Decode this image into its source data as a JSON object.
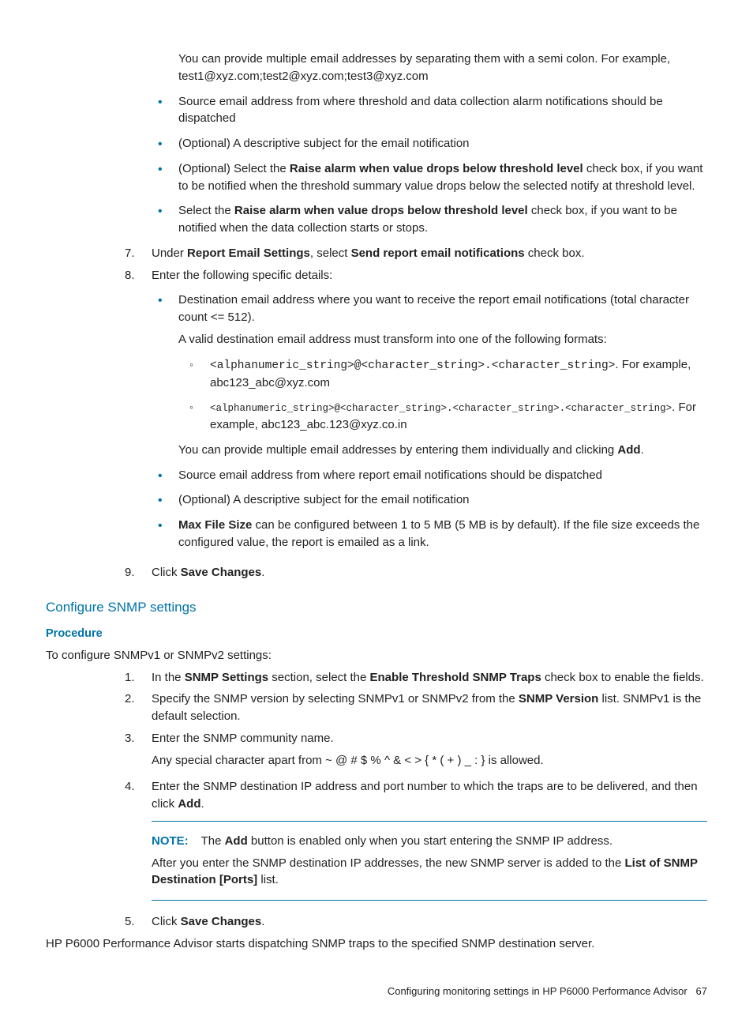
{
  "topBullets": {
    "intro": "You can provide multiple email addresses by separating them with a semi colon. For example, test1@xyz.com;test2@xyz.com;test3@xyz.com",
    "b1": "Source email address from where threshold and data collection alarm notifications should be dispatched",
    "b2": "(Optional) A descriptive subject for the email notification",
    "b3a": "(Optional) Select the ",
    "b3b": "Raise alarm when value drops below threshold level",
    "b3c": " check box, if you want to be notified when the threshold summary value drops below the selected notify at threshold level.",
    "b4a": "Select the ",
    "b4b": "Raise alarm when value drops below threshold level",
    "b4c": " check box, if you want to be notified when the data collection starts or stops."
  },
  "step7": {
    "num": "7.",
    "a": "Under ",
    "b": "Report Email Settings",
    "c": ", select ",
    "d": "Send report email notifications",
    "e": " check box."
  },
  "step8": {
    "num": "8.",
    "intro": "Enter the following specific details:",
    "b1a": "Destination email address where you want to receive the report email notifications (total character count <= 512).",
    "b1b": "A valid destination email address must transform into one of the following formats:",
    "r1a": "<alphanumeric_string>@<character_string>.<character_string>",
    "r1b": ". For example, abc123_abc@xyz.com",
    "r2a": "<alphanumeric_string>@<character_string>.<character_string>.<character_string>",
    "r2b": ". For example, abc123_abc.123@xyz.co.in",
    "b1c_a": "You can provide multiple email addresses by entering them individually and clicking ",
    "b1c_b": "Add",
    "b1c_c": ".",
    "b2": "Source email address from where report email notifications should be dispatched",
    "b3": "(Optional) A descriptive subject for the email notification",
    "b4a": "Max File Size",
    "b4b": " can be configured between 1 to 5 MB (5 MB is by default). If the file size exceeds the configured value, the report is emailed as a link."
  },
  "step9": {
    "num": "9.",
    "a": "Click ",
    "b": "Save Changes",
    "c": "."
  },
  "snmp": {
    "title": "Configure SNMP settings",
    "procLabel": "Procedure",
    "intro": "To configure SNMPv1 or SNMPv2 settings:",
    "s1": {
      "num": "1.",
      "a": "In the ",
      "b": "SNMP Settings",
      "c": " section, select the ",
      "d": "Enable Threshold SNMP Traps",
      "e": " check box to enable the fields."
    },
    "s2": {
      "num": "2.",
      "a": "Specify the SNMP version by selecting SNMPv1 or SNMPv2 from the ",
      "b": "SNMP Version",
      "c": " list. SNMPv1 is the default selection."
    },
    "s3": {
      "num": "3.",
      "a": "Enter the SNMP community name.",
      "b": "Any special character apart from ~ @ # $ % ^ & < > { * ( + ) _ : } is allowed."
    },
    "s4": {
      "num": "4.",
      "a": "Enter the SNMP destination IP address and port number to which the traps are to be delivered, and then click ",
      "b": "Add",
      "c": "."
    },
    "note": {
      "label": "NOTE:",
      "l1a": "The ",
      "l1b": "Add",
      "l1c": " button is enabled only when you start entering the SNMP IP address.",
      "l2a": "After you enter the SNMP destination IP addresses, the new SNMP server is added to the ",
      "l2b": "List of SNMP Destination [Ports]",
      "l2c": " list."
    },
    "s5": {
      "num": "5.",
      "a": "Click ",
      "b": "Save Changes",
      "c": "."
    },
    "outro": "HP P6000 Performance Advisor starts dispatching SNMP traps to the specified SNMP destination server."
  },
  "footer": {
    "title": "Configuring monitoring settings in HP P6000 Performance Advisor",
    "page": "67"
  }
}
